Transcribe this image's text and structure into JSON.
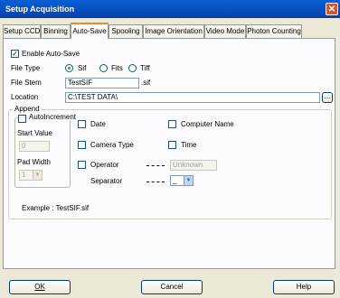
{
  "window": {
    "title": "Setup Acquisition",
    "close_glyph": "✕"
  },
  "tabs": [
    {
      "label": "Setup CCD"
    },
    {
      "label": "Binning"
    },
    {
      "label": "Auto-Save"
    },
    {
      "label": "Spooling"
    },
    {
      "label": "Image Orientation"
    },
    {
      "label": "Video Mode"
    },
    {
      "label": "Photon Counting"
    }
  ],
  "autosave": {
    "enable_label": "Enable Auto-Save",
    "enable_checked": "✓",
    "file_type_label": "File Type",
    "file_types": [
      {
        "label": "Sif",
        "selected": true
      },
      {
        "label": "Fits",
        "selected": false
      },
      {
        "label": "Tiff",
        "selected": false
      }
    ],
    "file_stem_label": "File Stem",
    "file_stem_value": "TestSIF",
    "file_ext": ".sif",
    "location_label": "Location",
    "location_value": "C:\\TEST DATA\\",
    "browse_label": "..."
  },
  "append": {
    "legend": "Append",
    "autoincrement_label": "AutoIncrement",
    "start_value_label": "Start Value",
    "start_value": "0",
    "pad_width_label": "Pad Width",
    "pad_width_value": "1",
    "date_label": "Date",
    "computer_name_label": "Computer Name",
    "camera_type_label": "Camera Type",
    "time_label": "Time",
    "operator_label": "Operator",
    "operator_value": "Unknown",
    "separator_label": "Separator",
    "separator_value": "_",
    "example_text": "Example : TestSIF.sif"
  },
  "buttons": {
    "ok": "OK",
    "cancel": "Cancel",
    "help": "Help"
  },
  "icons": {
    "dropdown": "▼"
  }
}
